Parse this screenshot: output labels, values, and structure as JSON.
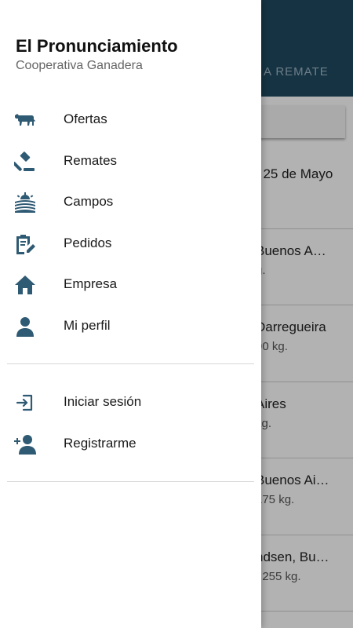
{
  "drawer": {
    "title": "El Pronunciamiento",
    "subtitle": "Cooperativa Ganadera",
    "menu": [
      {
        "label": "Ofertas",
        "icon": "cow-icon"
      },
      {
        "label": "Remates",
        "icon": "gavel-icon"
      },
      {
        "label": "Campos",
        "icon": "field-sunrise-icon"
      },
      {
        "label": "Pedidos",
        "icon": "clipboard-edit-icon"
      },
      {
        "label": "Empresa",
        "icon": "home-icon"
      },
      {
        "label": "Mi perfil",
        "icon": "user-icon"
      }
    ],
    "account": [
      {
        "label": "Iniciar sesión",
        "icon": "login-icon"
      },
      {
        "label": "Registrarme",
        "icon": "add-user-icon"
      }
    ]
  },
  "background": {
    "tab_label": "A REMATE",
    "rows": [
      {
        "line1": ", 25 de Mayo",
        "line2": ""
      },
      {
        "line1": "Buenos A…",
        "line2": "g."
      },
      {
        "line1": "Darregueira",
        "line2": "90 kg."
      },
      {
        "line1": "Aires",
        "line2": "kg."
      },
      {
        "line1": "Buenos Ai…",
        "line2": "175 kg."
      },
      {
        "line1": "ndsen, Bu…",
        "line2": ". 255 kg."
      },
      {
        "line1": "",
        "line2": ""
      }
    ]
  },
  "colors": {
    "header": "#1f4a61",
    "icon": "#2f5a73"
  }
}
